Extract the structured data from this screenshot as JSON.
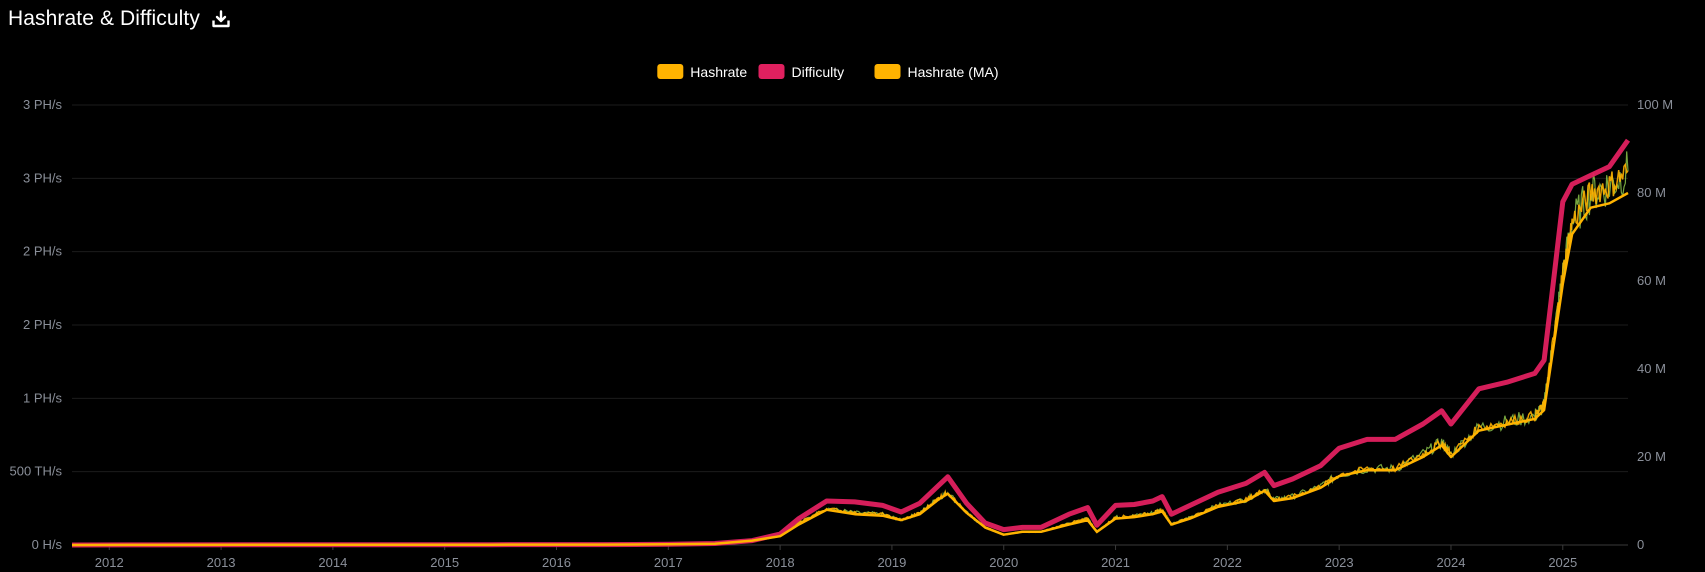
{
  "header": {
    "title": "Hashrate & Difficulty",
    "download_icon": "download-icon"
  },
  "colors": {
    "hashrate": "#ffb300",
    "difficulty": "#e0205f",
    "hashrate_ma": "#ffb300",
    "hashrate_raw_line": "#8bc34a",
    "grid": "#1c1c1c",
    "tick_text": "#8a8f99",
    "background": "#000000"
  },
  "chart_data": {
    "type": "line",
    "title": "Hashrate & Difficulty",
    "legend": {
      "placement": "top-center",
      "entries": [
        "Hashrate",
        "Difficulty",
        "Hashrate (MA)"
      ]
    },
    "grid": true,
    "x_range": [
      "2011-09",
      "2025-08"
    ],
    "x_tick_labels": [
      "2012",
      "2013",
      "2014",
      "2015",
      "2016",
      "2017",
      "2018",
      "2019",
      "2020",
      "2021",
      "2022",
      "2023",
      "2024",
      "2025"
    ],
    "y_left": {
      "unit": "H/s",
      "range_phs": [
        0,
        3.0
      ],
      "tick_values_phs": [
        0,
        0.5,
        1,
        1.5,
        2,
        2.5,
        3
      ],
      "tick_labels": [
        "0 H/s",
        "500 TH/s",
        "1 PH/s",
        "2 PH/s",
        "2 PH/s",
        "3 PH/s",
        "3 PH/s"
      ]
    },
    "y_right": {
      "range": [
        0,
        100000000
      ],
      "tick_values": [
        0,
        20000000,
        40000000,
        60000000,
        80000000,
        100000000
      ],
      "tick_labels": [
        "0",
        "20 M",
        "40 M",
        "60 M",
        "80 M",
        "100 M"
      ]
    },
    "x": [
      "2011-09",
      "2012-06",
      "2013-06",
      "2014-06",
      "2015-06",
      "2016-06",
      "2017-01",
      "2017-06",
      "2017-10",
      "2018-01",
      "2018-03",
      "2018-06",
      "2018-09",
      "2018-12",
      "2019-02",
      "2019-04",
      "2019-06",
      "2019-07",
      "2019-09",
      "2019-11",
      "2020-01",
      "2020-03",
      "2020-05",
      "2020-08",
      "2020-10",
      "2020-11",
      "2021-01",
      "2021-03",
      "2021-05",
      "2021-06",
      "2021-07",
      "2021-09",
      "2021-12",
      "2022-03",
      "2022-05",
      "2022-06",
      "2022-08",
      "2022-11",
      "2023-01",
      "2023-04",
      "2023-07",
      "2023-10",
      "2023-12",
      "2024-01",
      "2024-04",
      "2024-07",
      "2024-10",
      "2024-11",
      "2024-12",
      "2025-01",
      "2025-02",
      "2025-04",
      "2025-06",
      "2025-08"
    ],
    "series": [
      {
        "name": "Hashrate",
        "axis": "left",
        "values_phs": [
          0,
          0.001,
          0.002,
          0.002,
          0.002,
          0.003,
          0.005,
          0.01,
          0.03,
          0.06,
          0.15,
          0.25,
          0.22,
          0.21,
          0.17,
          0.22,
          0.32,
          0.36,
          0.22,
          0.12,
          0.07,
          0.09,
          0.09,
          0.15,
          0.18,
          0.09,
          0.19,
          0.2,
          0.22,
          0.24,
          0.14,
          0.19,
          0.27,
          0.31,
          0.38,
          0.31,
          0.33,
          0.4,
          0.48,
          0.52,
          0.52,
          0.62,
          0.7,
          0.62,
          0.8,
          0.84,
          0.88,
          0.95,
          1.4,
          1.85,
          2.2,
          2.4,
          2.45,
          2.55
        ]
      },
      {
        "name": "Difficulty",
        "axis": "right",
        "values": [
          0,
          30000,
          60000,
          70000,
          70000,
          80000,
          150000,
          350000,
          1000000,
          2500000,
          6000000,
          10000000,
          9800000,
          9000000,
          7500000,
          9500000,
          13500000,
          15500000,
          9500000,
          5000000,
          3500000,
          4000000,
          4000000,
          7000000,
          8500000,
          4500000,
          9000000,
          9200000,
          10000000,
          11000000,
          7000000,
          9000000,
          12000000,
          14000000,
          16500000,
          13500000,
          15000000,
          18000000,
          22000000,
          24000000,
          24000000,
          27500000,
          30500000,
          27500000,
          35500000,
          37000000,
          39000000,
          42000000,
          60000000,
          78000000,
          82000000,
          84000000,
          86000000,
          92000000
        ]
      },
      {
        "name": "Hashrate (MA)",
        "axis": "left",
        "values_phs": [
          0,
          0.001,
          0.002,
          0.002,
          0.002,
          0.003,
          0.005,
          0.009,
          0.03,
          0.06,
          0.14,
          0.24,
          0.21,
          0.2,
          0.17,
          0.21,
          0.31,
          0.35,
          0.22,
          0.12,
          0.07,
          0.09,
          0.09,
          0.14,
          0.17,
          0.09,
          0.18,
          0.19,
          0.21,
          0.23,
          0.14,
          0.18,
          0.26,
          0.3,
          0.37,
          0.3,
          0.32,
          0.39,
          0.47,
          0.51,
          0.51,
          0.6,
          0.68,
          0.6,
          0.78,
          0.82,
          0.86,
          0.92,
          1.35,
          1.78,
          2.12,
          2.3,
          2.33,
          2.4
        ]
      }
    ]
  }
}
